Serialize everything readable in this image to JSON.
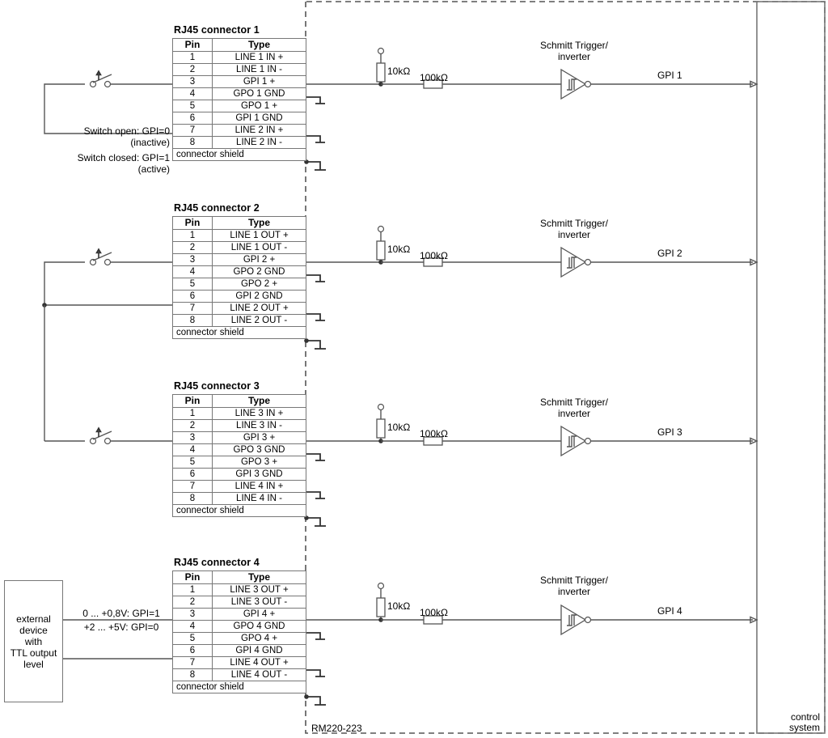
{
  "diagram": {
    "device_label": "RM220-223",
    "control_system_label": "control\nsystem",
    "control_system_line1": "control",
    "control_system_line2": "system"
  },
  "connectors": [
    {
      "title": "RJ45 connector 1",
      "header": {
        "pin": "Pin",
        "type": "Type"
      },
      "rows": [
        {
          "pin": "1",
          "type": "LINE 1 IN +"
        },
        {
          "pin": "2",
          "type": "LINE 1 IN -"
        },
        {
          "pin": "3",
          "type": "GPI 1 +"
        },
        {
          "pin": "4",
          "type": "GPO 1 GND"
        },
        {
          "pin": "5",
          "type": "GPO 1 +"
        },
        {
          "pin": "6",
          "type": "GPI 1 GND"
        },
        {
          "pin": "7",
          "type": "LINE 2 IN +"
        },
        {
          "pin": "8",
          "type": "LINE 2 IN -"
        }
      ],
      "shield": "connector shield"
    },
    {
      "title": "RJ45 connector 2",
      "header": {
        "pin": "Pin",
        "type": "Type"
      },
      "rows": [
        {
          "pin": "1",
          "type": "LINE 1 OUT +"
        },
        {
          "pin": "2",
          "type": "LINE 1 OUT -"
        },
        {
          "pin": "3",
          "type": "GPI 2 +"
        },
        {
          "pin": "4",
          "type": "GPO 2 GND"
        },
        {
          "pin": "5",
          "type": "GPO 2 +"
        },
        {
          "pin": "6",
          "type": "GPI 2 GND"
        },
        {
          "pin": "7",
          "type": "LINE 2 OUT +"
        },
        {
          "pin": "8",
          "type": "LINE 2 OUT -"
        }
      ],
      "shield": "connector shield"
    },
    {
      "title": "RJ45 connector 3",
      "header": {
        "pin": "Pin",
        "type": "Type"
      },
      "rows": [
        {
          "pin": "1",
          "type": "LINE 3 IN +"
        },
        {
          "pin": "2",
          "type": "LINE 3 IN -"
        },
        {
          "pin": "3",
          "type": "GPI 3 +"
        },
        {
          "pin": "4",
          "type": "GPO 3 GND"
        },
        {
          "pin": "5",
          "type": "GPO 3 +"
        },
        {
          "pin": "6",
          "type": "GPI 3 GND"
        },
        {
          "pin": "7",
          "type": "LINE 4 IN +"
        },
        {
          "pin": "8",
          "type": "LINE 4 IN -"
        }
      ],
      "shield": "connector shield"
    },
    {
      "title": "RJ45 connector 4",
      "header": {
        "pin": "Pin",
        "type": "Type"
      },
      "rows": [
        {
          "pin": "1",
          "type": "LINE 3 OUT +"
        },
        {
          "pin": "2",
          "type": "LINE 3 OUT -"
        },
        {
          "pin": "3",
          "type": "GPI 4 +"
        },
        {
          "pin": "4",
          "type": "GPO 4 GND"
        },
        {
          "pin": "5",
          "type": "GPO 4 +"
        },
        {
          "pin": "6",
          "type": "GPI 4 GND"
        },
        {
          "pin": "7",
          "type": "LINE 4 OUT +"
        },
        {
          "pin": "8",
          "type": "LINE 4 OUT -"
        }
      ],
      "shield": "connector shield"
    }
  ],
  "circuits": [
    {
      "pullup_resistor": "10kΩ",
      "series_resistor": "100kΩ",
      "trigger_label_line1": "Schmitt Trigger/",
      "trigger_label_line2": "inverter",
      "output_label": "GPI 1"
    },
    {
      "pullup_resistor": "10kΩ",
      "series_resistor": "100kΩ",
      "trigger_label_line1": "Schmitt Trigger/",
      "trigger_label_line2": "inverter",
      "output_label": "GPI 2"
    },
    {
      "pullup_resistor": "10kΩ",
      "series_resistor": "100kΩ",
      "trigger_label_line1": "Schmitt Trigger/",
      "trigger_label_line2": "inverter",
      "output_label": "GPI 3"
    },
    {
      "pullup_resistor": "10kΩ",
      "series_resistor": "100kΩ",
      "trigger_label_line1": "Schmitt Trigger/",
      "trigger_label_line2": "inverter",
      "output_label": "GPI 4"
    }
  ],
  "annotations": {
    "switch_open_line1": "Switch open: GPI=0",
    "switch_open_line2": "(inactive)",
    "switch_closed_line1": "Switch closed: GPI=1",
    "switch_closed_line2": "(active)",
    "ttl_high_label": "0 ... +0,8V: GPI=1",
    "ttl_low_label": "+2 ... +5V: GPI=0"
  },
  "external_device": {
    "line1": "external",
    "line2": "device",
    "line3": "with",
    "line4": "TTL output",
    "line5": "level"
  }
}
